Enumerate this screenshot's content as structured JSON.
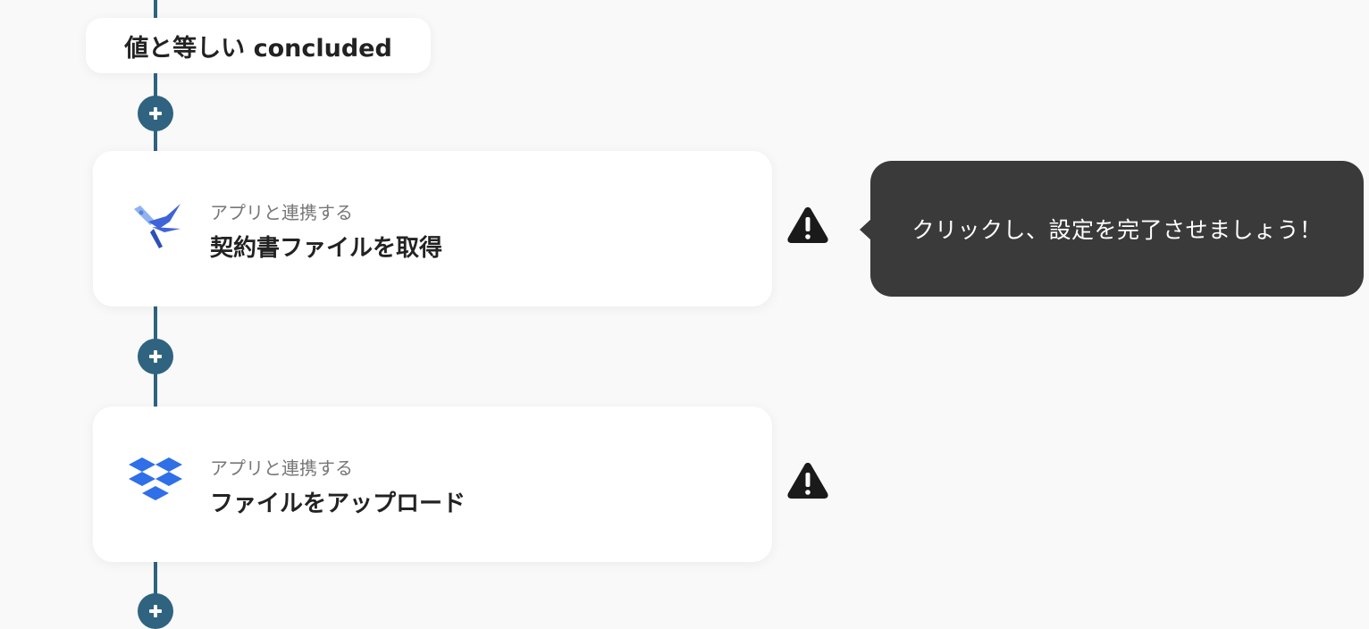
{
  "condition": {
    "label": "値と等しい concluded"
  },
  "steps": [
    {
      "subtitle": "アプリと連携する",
      "title": "契約書ファイルを取得",
      "icon": "cloudsign-swallow-icon",
      "status": "warning"
    },
    {
      "subtitle": "アプリと連携する",
      "title": "ファイルをアップロード",
      "icon": "dropbox-icon",
      "status": "warning"
    }
  ],
  "tooltip": {
    "text": "クリックし、設定を完了させましょう！"
  },
  "colors": {
    "connector": "#2f6380",
    "background": "#f9f9f9",
    "tooltip": "#3a3a3a",
    "warning": "#1a1a1a",
    "dropbox": "#2f6fe8",
    "swallow": "#3f63d8"
  }
}
